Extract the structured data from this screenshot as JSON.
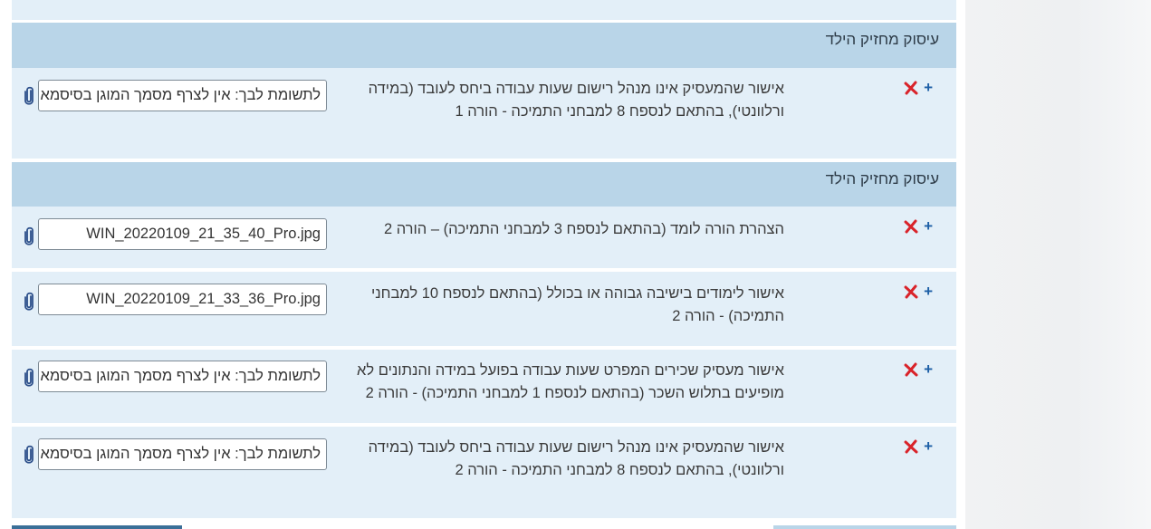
{
  "colors": {
    "header_bg": "#b9d5e8",
    "row_bg": "#e3eff8",
    "add_icon": "#1d5fa6",
    "remove_icon": "#d9232a",
    "attach_icon": "#2c4f8a"
  },
  "sections": [
    {
      "title": "עיסוק מחזיק הילד",
      "rows": [
        {
          "line1": "אישור שהמעסיק אינו מנהל רישום שעות עבודה ביחס לעובד (במידה",
          "line2": "ורלוונטי), בהתאם לנספח 8 למבחני התמיכה - הורה 1",
          "file_value": "לתשומת לבך: אין לצרף מסמך המוגן בסיסמא"
        }
      ]
    },
    {
      "title": "עיסוק מחזיק הילד",
      "rows": [
        {
          "line1": "הצהרת הורה לומד (בהתאם לנספח 3 למבחני התמיכה) – הורה 2",
          "line2": "",
          "file_value": "WIN_20220109_21_35_40_Pro.jpg"
        },
        {
          "line1": "אישור לימודים בישיבה גבוהה או בכולל (בהתאם לנספח 10 למבחני",
          "line2": "התמיכה) - הורה 2",
          "file_value": "WIN_20220109_21_33_36_Pro.jpg"
        },
        {
          "line1": "אישור מעסיק שכירים המפרט שעות עבודה בפועל במידה והנתונים לא",
          "line2": "מופיעים בתלוש השכר (בהתאם לנספח 1 למבחני התמיכה) - הורה 2",
          "file_value": "לתשומת לבך: אין לצרף מסמך המוגן בסיסמא"
        },
        {
          "line1": "אישור שהמעסיק אינו מנהל רישום שעות עבודה ביחס לעובד (במידה",
          "line2": "ורלוונטי), בהתאם לנספח 8 למבחני התמיכה - הורה 2",
          "file_value": "לתשומת לבך: אין לצרף מסמך המוגן בסיסמא"
        }
      ]
    }
  ],
  "icons": {
    "add": "plus-icon",
    "remove": "red-x-icon",
    "attach": "paperclip-icon"
  },
  "add_glyph": "+"
}
